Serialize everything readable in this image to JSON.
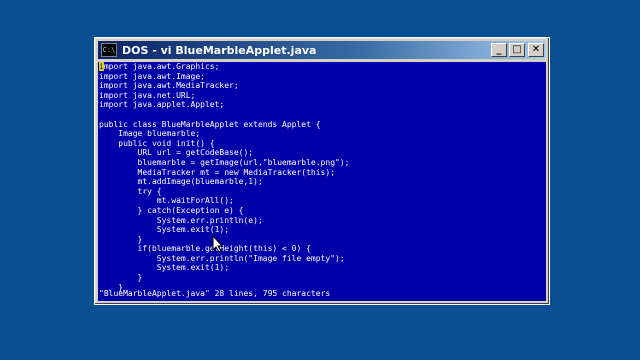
{
  "window": {
    "title": "DOS - vi BlueMarbleApplet.java",
    "sys_icon": "C:\\",
    "minimize_label": "_",
    "maximize_label": "□",
    "close_label": "✕"
  },
  "editor": {
    "cursor_char": "i",
    "first_line_rest": "mport java.awt.Graphics;",
    "lines": [
      "import java.awt.Image;",
      "import java.awt.MediaTracker;",
      "import java.net.URL;",
      "import java.applet.Applet;",
      "",
      "public class BlueMarbleApplet extends Applet {",
      "    Image bluemarble;",
      "    public void init() {",
      "        URL url = getCodeBase();",
      "        bluemarble = getImage(url,\"bluemarble.png\");",
      "        MediaTracker mt = new MediaTracker(this);",
      "        mt.addImage(bluemarble,1);",
      "        try {",
      "            mt.waitForAll();",
      "        } catch(Exception e) {",
      "            System.err.println(e);",
      "            System.exit(1);",
      "        }",
      "        if(bluemarble.getHeight(this) < 0) {",
      "            System.err.println(\"Image file empty\");",
      "            System.exit(1);",
      "        }",
      "    }"
    ],
    "status_line": "\"BlueMarbleApplet.java\" 28 lines, 795 characters"
  }
}
